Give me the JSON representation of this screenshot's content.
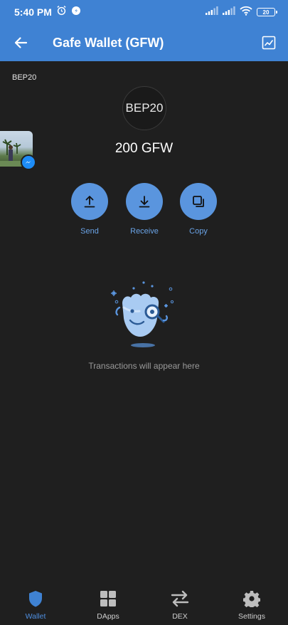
{
  "status_bar": {
    "time": "5:40 PM",
    "battery": "20"
  },
  "app_bar": {
    "title": "Gafe Wallet (GFW)"
  },
  "token": {
    "network": "BEP20",
    "logo_text": "BEP20",
    "balance": "200 GFW"
  },
  "actions": [
    {
      "label": "Send"
    },
    {
      "label": "Receive"
    },
    {
      "label": "Copy"
    }
  ],
  "empty_state": {
    "message": "Transactions will appear here"
  },
  "bottom_nav": [
    {
      "label": "Wallet",
      "icon": "shield-icon",
      "active": true
    },
    {
      "label": "DApps",
      "icon": "grid-icon",
      "active": false
    },
    {
      "label": "DEX",
      "icon": "swap-icon",
      "active": false
    },
    {
      "label": "Settings",
      "icon": "gear-icon",
      "active": false
    }
  ],
  "colors": {
    "primary": "#3f82d3",
    "action": "#5a95de",
    "background": "#1f1f1f",
    "accent_text": "#6aa3e6"
  }
}
